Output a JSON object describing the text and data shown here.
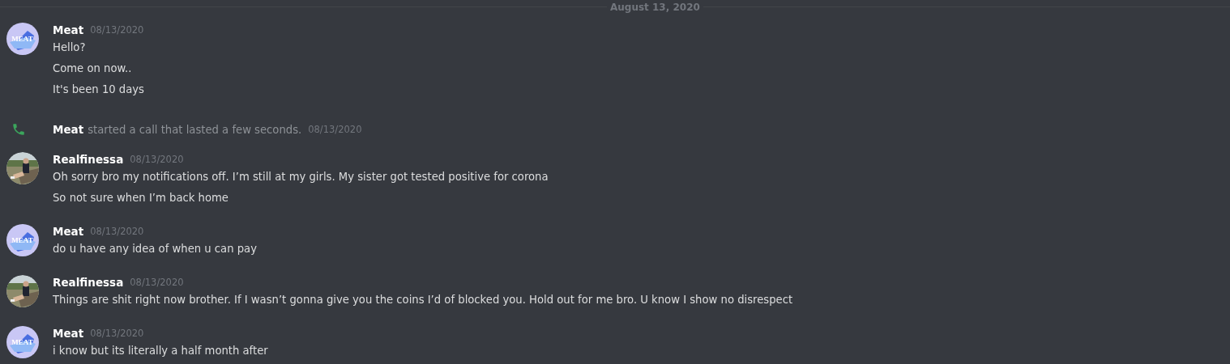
{
  "divider": {
    "label": "August 13, 2020"
  },
  "messages": [
    {
      "kind": "message",
      "author": "Meat",
      "avatar": {
        "kind": "logo",
        "text": "MEAT"
      },
      "timestamp": "08/13/2020",
      "lines": [
        "Hello?",
        "Come on now..",
        "It's been 10 days"
      ]
    },
    {
      "kind": "call",
      "author": "Meat",
      "text": "started a call that lasted a few seconds.",
      "timestamp": "08/13/2020"
    },
    {
      "kind": "message",
      "author": "Realfinessa",
      "avatar": {
        "kind": "picture"
      },
      "timestamp": "08/13/2020",
      "lines": [
        "Oh sorry bro my notifications off. I’m still at my girls. My sister got tested positive for corona",
        "So not sure when I’m back home"
      ]
    },
    {
      "kind": "message",
      "author": "Meat",
      "avatar": {
        "kind": "logo",
        "text": "MEAT"
      },
      "timestamp": "08/13/2020",
      "lines": [
        "do u have any idea of when u can pay"
      ]
    },
    {
      "kind": "message",
      "author": "Realfinessa",
      "avatar": {
        "kind": "picture"
      },
      "timestamp": "08/13/2020",
      "lines": [
        "Things are shit right now brother. If I wasn’t gonna give you the coins I’d of blocked you. Hold out for me bro. U know I show no disrespect"
      ]
    },
    {
      "kind": "message",
      "author": "Meat",
      "avatar": {
        "kind": "logo",
        "text": "MEAT"
      },
      "timestamp": "08/13/2020",
      "lines": [
        "i know but its literally a half month after"
      ]
    }
  ]
}
